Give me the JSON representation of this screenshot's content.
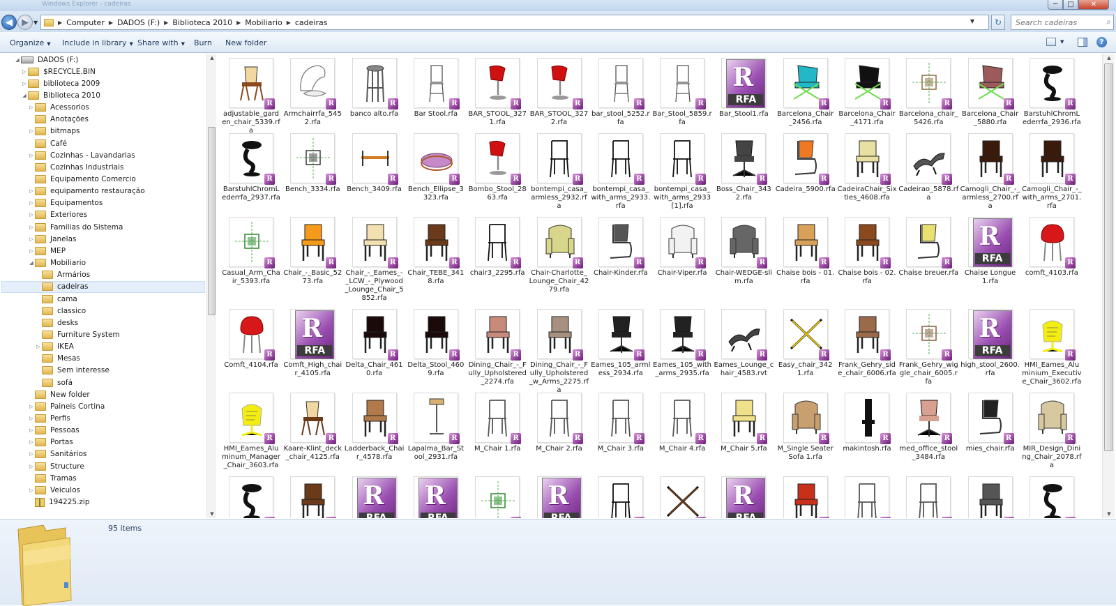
{
  "window": {
    "title": "Windows Explorer - cadeiras",
    "minimize": "─",
    "maximize": "□",
    "close": "✕"
  },
  "nav": {
    "back": "◀",
    "forward": "▶",
    "recent": "▼",
    "refresh": "↻"
  },
  "address": {
    "crumbs": [
      "Computer",
      "DADOS (F:)",
      "Biblioteca 2010",
      "Mobiliario",
      "cadeiras"
    ]
  },
  "search": {
    "placeholder": "Search cadeiras"
  },
  "toolbar": {
    "organize": "Organize",
    "include": "Include in library",
    "share": "Share with",
    "burn": "Burn",
    "new_folder": "New folder"
  },
  "tree": [
    {
      "label": "DADOS (F:)",
      "level": 0,
      "expanded": true,
      "kind": "drive"
    },
    {
      "label": "$RECYCLE.BIN",
      "level": 1,
      "expanded": false,
      "kind": "folder"
    },
    {
      "label": "biblioteca 2009",
      "level": 1,
      "expanded": false,
      "kind": "folder"
    },
    {
      "label": "Biblioteca 2010",
      "level": 1,
      "expanded": true,
      "kind": "folder"
    },
    {
      "label": "Acessorios",
      "level": 2,
      "expanded": false,
      "kind": "folder"
    },
    {
      "label": "Anotações",
      "level": 2,
      "expanded": null,
      "kind": "folder"
    },
    {
      "label": "bitmaps",
      "level": 2,
      "expanded": false,
      "kind": "folder"
    },
    {
      "label": "Café",
      "level": 2,
      "expanded": null,
      "kind": "folder"
    },
    {
      "label": "Cozinhas - Lavandarias",
      "level": 2,
      "expanded": false,
      "kind": "folder"
    },
    {
      "label": "Cozinhas Industriais",
      "level": 2,
      "expanded": null,
      "kind": "folder"
    },
    {
      "label": "Equipamento Comercio",
      "level": 2,
      "expanded": null,
      "kind": "folder"
    },
    {
      "label": "equipamento restauração",
      "level": 2,
      "expanded": false,
      "kind": "folder"
    },
    {
      "label": "Equipamentos",
      "level": 2,
      "expanded": false,
      "kind": "folder"
    },
    {
      "label": "Exteriores",
      "level": 2,
      "expanded": false,
      "kind": "folder"
    },
    {
      "label": "Familias do Sistema",
      "level": 2,
      "expanded": false,
      "kind": "folder"
    },
    {
      "label": "Janelas",
      "level": 2,
      "expanded": false,
      "kind": "folder"
    },
    {
      "label": "MEP",
      "level": 2,
      "expanded": false,
      "kind": "folder"
    },
    {
      "label": "Mobiliario",
      "level": 2,
      "expanded": true,
      "kind": "folder"
    },
    {
      "label": "Armários",
      "level": 3,
      "expanded": null,
      "kind": "folder"
    },
    {
      "label": "cadeiras",
      "level": 3,
      "expanded": null,
      "kind": "folder",
      "selected": true
    },
    {
      "label": "cama",
      "level": 3,
      "expanded": null,
      "kind": "folder"
    },
    {
      "label": "classico",
      "level": 3,
      "expanded": null,
      "kind": "folder"
    },
    {
      "label": "desks",
      "level": 3,
      "expanded": null,
      "kind": "folder"
    },
    {
      "label": "Furniture System",
      "level": 3,
      "expanded": null,
      "kind": "folder"
    },
    {
      "label": "IKEA",
      "level": 3,
      "expanded": false,
      "kind": "folder"
    },
    {
      "label": "Mesas",
      "level": 3,
      "expanded": null,
      "kind": "folder"
    },
    {
      "label": "Sem interesse",
      "level": 3,
      "expanded": null,
      "kind": "folder"
    },
    {
      "label": "sofá",
      "level": 3,
      "expanded": null,
      "kind": "folder"
    },
    {
      "label": "New folder",
      "level": 2,
      "expanded": null,
      "kind": "folder"
    },
    {
      "label": "Paineis Cortina",
      "level": 2,
      "expanded": false,
      "kind": "folder"
    },
    {
      "label": "Perfis",
      "level": 2,
      "expanded": false,
      "kind": "folder"
    },
    {
      "label": "Pessoas",
      "level": 2,
      "expanded": false,
      "kind": "folder"
    },
    {
      "label": "Portas",
      "level": 2,
      "expanded": false,
      "kind": "folder"
    },
    {
      "label": "Sanitários",
      "level": 2,
      "expanded": false,
      "kind": "folder"
    },
    {
      "label": "Structure",
      "level": 2,
      "expanded": false,
      "kind": "folder"
    },
    {
      "label": "Tramas",
      "level": 2,
      "expanded": null,
      "kind": "folder"
    },
    {
      "label": "Veiculos",
      "level": 2,
      "expanded": false,
      "kind": "folder"
    },
    {
      "label": "194225.zip",
      "level": 2,
      "expanded": null,
      "kind": "zip"
    }
  ],
  "files": [
    {
      "name": "adjustable_garden_chair_5339.rfa",
      "icon": "garden-chair",
      "color": "#8a4a1e"
    },
    {
      "name": "Armchairrfa_5452.rfa",
      "icon": "egg-chair",
      "color": "#777777"
    },
    {
      "name": "banco alto.rfa",
      "icon": "stool",
      "color": "#555555"
    },
    {
      "name": "Bar Stool.rfa",
      "icon": "bar-stool-line",
      "color": "#555555"
    },
    {
      "name": "BAR_STOOL_3271.rfa",
      "icon": "red-stool",
      "color": "#d01010"
    },
    {
      "name": "BAR_STOOL_3272.rfa",
      "icon": "red-stool",
      "color": "#d01010"
    },
    {
      "name": "bar_stool_5252.rfa",
      "icon": "bar-stool-line",
      "color": "#555555"
    },
    {
      "name": "Bar_Stool_5859.rfa",
      "icon": "bar-stool-line",
      "color": "#555555"
    },
    {
      "name": "Bar_Stool1.rfa",
      "icon": "rfa",
      "color": ""
    },
    {
      "name": "Barcelona_Chair_2456.rfa",
      "icon": "barcelona",
      "color": "#22b8c8"
    },
    {
      "name": "Barcelona_Chair_4171.rfa",
      "icon": "barcelona",
      "color": "#111111"
    },
    {
      "name": "Barcelona_chair_5426.rfa",
      "icon": "plan",
      "color": "#8a6d3b"
    },
    {
      "name": "Barcelona_Chair_5880.rfa",
      "icon": "barcelona",
      "color": "#9c5a5a"
    },
    {
      "name": "BarstuhlChromLederrfa_2936.rfa",
      "icon": "black-stool",
      "color": "#111111"
    },
    {
      "name": "BarstuhlChromLederrfa_2937.rfa",
      "icon": "black-stool",
      "color": "#111111"
    },
    {
      "name": "Bench_3334.rfa",
      "icon": "plan",
      "color": "#3a3a3a"
    },
    {
      "name": "Bench_3409.rfa",
      "icon": "bench",
      "color": "#d77a1e"
    },
    {
      "name": "Bench_Ellipse_3323.rfa",
      "icon": "ellipse-bench",
      "color": "#c68ac8"
    },
    {
      "name": "Bombo_Stool_2863.rfa",
      "icon": "red-stool",
      "color": "#d01010"
    },
    {
      "name": "bontempi_casa_armless_2932.rfa",
      "icon": "chair-line",
      "color": "#111111"
    },
    {
      "name": "bontempi_casa_with_arms_2933.rfa",
      "icon": "chair-line",
      "color": "#111111"
    },
    {
      "name": "bontempi_casa_with_arms_2933[1].rfa",
      "icon": "chair-line",
      "color": "#111111"
    },
    {
      "name": "Boss_Chair_3432.rfa",
      "icon": "office-chair",
      "color": "#444444"
    },
    {
      "name": "Cadeira_5900.rfa",
      "icon": "cantilever",
      "color": "#f07820"
    },
    {
      "name": "CadeiraChair_Sixties_4608.rfa",
      "icon": "chair-solid",
      "color": "#e8e0a0"
    },
    {
      "name": "Cadeirao_5878.rfa",
      "icon": "lounger",
      "color": "#555555"
    },
    {
      "name": "Camogli_Chair_-_armless_2700.rfa",
      "icon": "chair-solid",
      "color": "#3a1a0a"
    },
    {
      "name": "Camogli_Chair_-_with_arms_2701.rfa",
      "icon": "chair-solid",
      "color": "#3a1a0a"
    },
    {
      "name": "Casual_Arm_Chair_5393.rfa",
      "icon": "plan",
      "color": "#2a8a2a"
    },
    {
      "name": "Chair_-_Basic_5273.rfa",
      "icon": "chair-solid",
      "color": "#f59a1a"
    },
    {
      "name": "Chair_-_Eames_-_LCW_-_Plywood_Lounge_Chair_5852.rfa",
      "icon": "chair-solid",
      "color": "#f2e0b0"
    },
    {
      "name": "Chair_TEBE_3418.rfa",
      "icon": "chair-solid",
      "color": "#6a3a1a"
    },
    {
      "name": "chair3_2295.rfa",
      "icon": "chair-line",
      "color": "#111111"
    },
    {
      "name": "Chair-Charlotte_Lounge_Chair_4279.rfa",
      "icon": "armchair",
      "color": "#d8d68a"
    },
    {
      "name": "Chair-Kinder.rfa",
      "icon": "cantilever",
      "color": "#555555"
    },
    {
      "name": "Chair-Viper.rfa",
      "icon": "armchair",
      "color": "#f2f2f2"
    },
    {
      "name": "Chair-WEDGE-slim.rfa",
      "icon": "armchair",
      "color": "#666666"
    },
    {
      "name": "Chaise bois - 01.rfa",
      "icon": "chair-solid",
      "color": "#d9a05a"
    },
    {
      "name": "Chaise bois - 02.rfa",
      "icon": "chair-solid",
      "color": "#8a4a1e"
    },
    {
      "name": "Chaise breuer.rfa",
      "icon": "cantilever",
      "color": "#e8e070"
    },
    {
      "name": "Chaise Longue 1.rfa",
      "icon": "rfa",
      "color": ""
    },
    {
      "name": "comft_4103.rfa",
      "icon": "red-round",
      "color": "#d81818"
    },
    {
      "name": "Comft_4104.rfa",
      "icon": "red-round",
      "color": "#d81818"
    },
    {
      "name": "Comft_High_chair_4105.rfa",
      "icon": "rfa",
      "color": ""
    },
    {
      "name": "Delta_Chair_4610.rfa",
      "icon": "chair-solid",
      "color": "#1a0a0a"
    },
    {
      "name": "Delta_Stool_4609.rfa",
      "icon": "chair-solid",
      "color": "#1a0a0a"
    },
    {
      "name": "Dining_Chair_-_Fully_Upholstered_2274.rfa",
      "icon": "chair-solid",
      "color": "#c88a7a"
    },
    {
      "name": "Dining_Chair_-_Fully_Upholstered_w_Arms_2275.rfa",
      "icon": "chair-solid",
      "color": "#a89080"
    },
    {
      "name": "Eames_105_armless_2934.rfa",
      "icon": "office-chair",
      "color": "#222222"
    },
    {
      "name": "Eames_105_with_arms_2935.rfa",
      "icon": "office-chair",
      "color": "#222222"
    },
    {
      "name": "Eames_Lounge_chair_4583.rvt",
      "icon": "lounger",
      "color": "#444444"
    },
    {
      "name": "Easy_chair_3421.rfa",
      "icon": "easy-x",
      "color": "#e8c810"
    },
    {
      "name": "Frank_Gehry_side_chair_6006.rfa",
      "icon": "chair-solid",
      "color": "#9a6a4a"
    },
    {
      "name": "Frank_Gehry_wiggle_chair_6005.rfa",
      "icon": "plan",
      "color": "#8a5a3a"
    },
    {
      "name": "high_stool_2600.rfa",
      "icon": "rfa",
      "color": ""
    },
    {
      "name": "HMI_Eames_Aluminium_Executive_Chair_3602.rfa",
      "icon": "yellow-note",
      "color": "#f4ee10"
    },
    {
      "name": "HMI_Eames_Aluminum_Manager_Chair_3603.rfa",
      "icon": "yellow-note",
      "color": "#f4ee10"
    },
    {
      "name": "Kaare-Klint_deck_chair_4125.rfa",
      "icon": "garden-chair",
      "color": "#6a3a1a"
    },
    {
      "name": "Ladderback_Chair_4578.rfa",
      "icon": "chair-solid",
      "color": "#b07a4a"
    },
    {
      "name": "Lapalma_Bar_Stool_2931.rfa",
      "icon": "lapalma",
      "color": "#d8b070"
    },
    {
      "name": "M_Chair 1.rfa",
      "icon": "chair-line",
      "color": "#555555"
    },
    {
      "name": "M_Chair 2.rfa",
      "icon": "chair-line",
      "color": "#555555"
    },
    {
      "name": "M_Chair 3.rfa",
      "icon": "chair-line",
      "color": "#555555"
    },
    {
      "name": "M_Chair 4.rfa",
      "icon": "chair-line",
      "color": "#555555"
    },
    {
      "name": "M_Chair 5.rfa",
      "icon": "chair-solid",
      "color": "#f0e08a"
    },
    {
      "name": "M_Single Seater Sofa 1.rfa",
      "icon": "armchair",
      "color": "#c8a070"
    },
    {
      "name": "makintosh.rfa",
      "icon": "makintosh",
      "color": "#111111"
    },
    {
      "name": "med_office_stool_3484.rfa",
      "icon": "office-chair",
      "color": "#d8a090"
    },
    {
      "name": "mies_chair.rfa",
      "icon": "cantilever",
      "color": "#222222"
    },
    {
      "name": "MIR_Design_Dining_Chair_2078.rfa",
      "icon": "armchair",
      "color": "#d8c8a0"
    },
    {
      "name": "",
      "icon": "black-stool",
      "color": "#111111"
    },
    {
      "name": "",
      "icon": "chair-solid",
      "color": "#6a3a1a"
    },
    {
      "name": "",
      "icon": "rfa",
      "color": ""
    },
    {
      "name": "",
      "icon": "rfa",
      "color": ""
    },
    {
      "name": "",
      "icon": "plan",
      "color": "#2a8a2a"
    },
    {
      "name": "",
      "icon": "rfa",
      "color": ""
    },
    {
      "name": "",
      "icon": "chair-line",
      "color": "#111111"
    },
    {
      "name": "",
      "icon": "easy-x",
      "color": "#6a3a1a"
    },
    {
      "name": "",
      "icon": "rfa",
      "color": ""
    },
    {
      "name": "",
      "icon": "chair-solid",
      "color": "#c8301a"
    },
    {
      "name": "",
      "icon": "chair-line",
      "color": "#555555"
    },
    {
      "name": "",
      "icon": "chair-line",
      "color": "#555555"
    },
    {
      "name": "",
      "icon": "chair-solid",
      "color": "#555555"
    },
    {
      "name": "",
      "icon": "black-stool",
      "color": "#111111"
    }
  ],
  "badge": {
    "glyph": "R"
  },
  "rfa_label": "RFA",
  "details": {
    "count": "95 items"
  },
  "colors": {
    "accent": "#1e395b",
    "selection": "#e5eefb",
    "rfa": "#8a3a9a"
  }
}
